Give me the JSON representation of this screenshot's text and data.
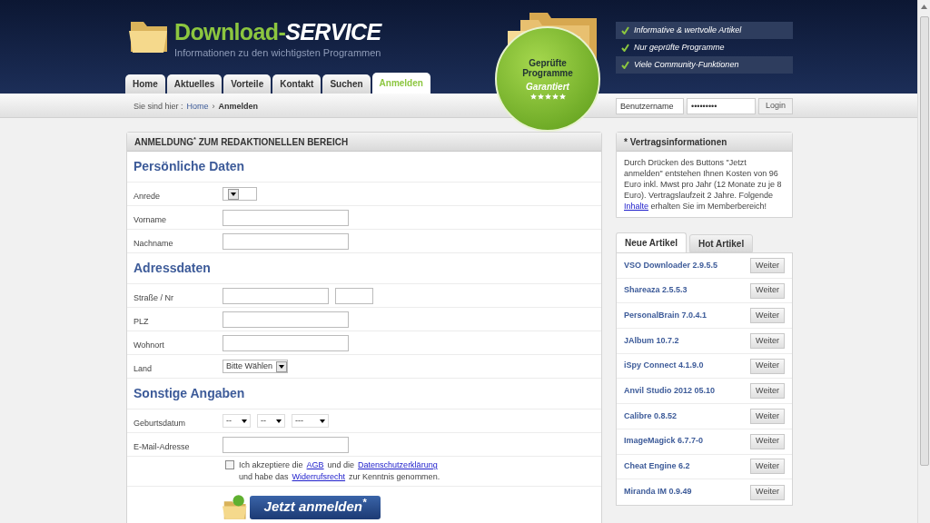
{
  "logo": {
    "title_green": "Download-",
    "title_white": "SERVICE",
    "tagline": "Informationen zu den wichtigsten Programmen"
  },
  "nav_tabs": [
    {
      "label": "Home",
      "selected": false
    },
    {
      "label": "Aktuelles",
      "selected": false
    },
    {
      "label": "Vorteile",
      "selected": false
    },
    {
      "label": "Kontakt",
      "selected": false
    },
    {
      "label": "Suchen",
      "selected": false
    },
    {
      "label": "Anmelden",
      "selected": true
    }
  ],
  "badge": {
    "line_1": "Geprüfte",
    "line_2": "Programme",
    "line_3": "Garantiert",
    "stars": 5
  },
  "features": [
    "Informative & wertvolle Artikel",
    "Nur geprüfte Programme",
    "Viele Community-Funktionen"
  ],
  "breadcrumb": {
    "prefix": "Sie sind hier :",
    "home": "Home",
    "separator": "›",
    "current": "Anmelden"
  },
  "login": {
    "username": "Benutzername",
    "password": "•••••••••",
    "button": "Login"
  },
  "form": {
    "title": "ANMELDUNG$^{*}$ ZUM REDAKTIONELLEN BEREICH",
    "sections": [
      {
        "title": "Persönliche Daten",
        "rows": [
          {
            "kind": "select",
            "label": "Anrede"
          },
          {
            "kind": "text",
            "label": "Vorname"
          },
          {
            "kind": "text",
            "label": "Nachname"
          }
        ]
      },
      {
        "title": "Adressdaten",
        "rows": [
          {
            "kind": "pair",
            "label": "Straße / Nr"
          },
          {
            "kind": "text",
            "label": "PLZ"
          },
          {
            "kind": "text",
            "label": "Wohnort"
          },
          {
            "kind": "select",
            "label": "Land",
            "value": "Bitte Wählen"
          }
        ]
      },
      {
        "title": "Sonstige Angaben",
        "rows": [
          {
            "kind": "date",
            "label": "Geburtsdatum",
            "parts": [
              "--",
              "--",
              "---"
            ]
          },
          {
            "kind": "text",
            "label": "E-Mail-Adresse"
          },
          {
            "kind": "terms",
            "checked": false,
            "lines": [
              [
                {
                  "text": "Ich akzeptiere die",
                  "link": false
                },
                {
                  "text": "AGB",
                  "link": true
                },
                {
                  "text": "und die",
                  "link": false
                },
                {
                  "text": "Datenschutzerklärung",
                  "link": true
                }
              ],
              [
                {
                  "text": "und habe das",
                  "link": false
                },
                {
                  "text": "Widerrufsrecht",
                  "link": true
                },
                {
                  "text": "zur Kenntnis genommen.",
                  "link": false
                }
              ]
            ]
          }
        ]
      }
    ],
    "submit": "Jetzt anmelden$^{*}$"
  },
  "contract": {
    "title": "* Vertragsinformationen",
    "text_before": "Durch Drücken des Buttons \"Jetzt anmelden\" entstehen Ihnen Kosten von 96 Euro inkl. Mwst pro Jahr (12 Monate zu je 8 Euro). Vertragslaufzeit 2 Jahre. Folgende",
    "link": "Inhalte",
    "text_after": "erhalten Sie im Memberbereich!"
  },
  "article_tabs": [
    {
      "label": "Neue Artikel",
      "selected": true
    },
    {
      "label": "Hot Artikel",
      "selected": false
    }
  ],
  "articles": [
    {
      "name": "VSO Downloader 2.9.5.5",
      "button": "Weiter"
    },
    {
      "name": "Shareaza 2.5.5.3",
      "button": "Weiter"
    },
    {
      "name": "PersonalBrain 7.0.4.1",
      "button": "Weiter"
    },
    {
      "name": "JAlbum 10.7.2",
      "button": "Weiter"
    },
    {
      "name": "iSpy Connect 4.1.9.0",
      "button": "Weiter"
    },
    {
      "name": "Anvil Studio 2012 05.10",
      "button": "Weiter"
    },
    {
      "name": "Calibre 0.8.52",
      "button": "Weiter"
    },
    {
      "name": "ImageMagick 6.7.7-0",
      "button": "Weiter"
    },
    {
      "name": "Cheat Engine 6.2",
      "button": "Weiter"
    },
    {
      "name": "Miranda IM 0.9.49",
      "button": "Weiter"
    }
  ]
}
